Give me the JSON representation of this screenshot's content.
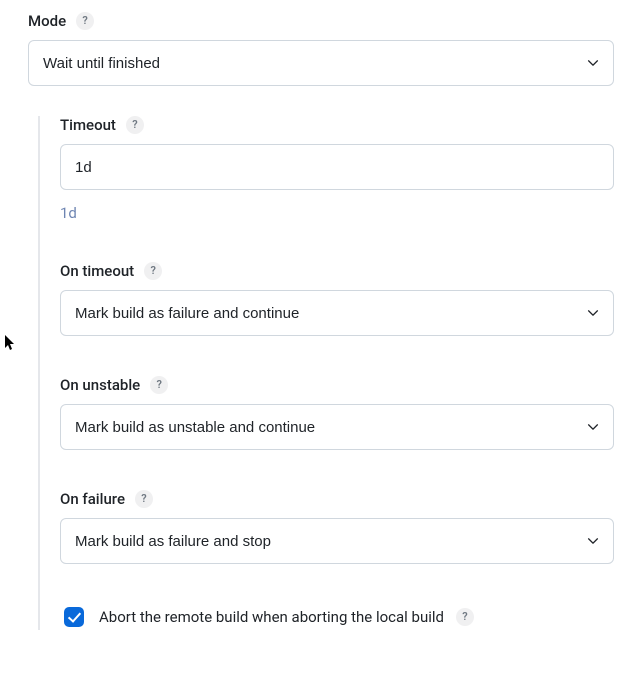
{
  "mode": {
    "label": "Mode",
    "value": "Wait until finished"
  },
  "timeout": {
    "label": "Timeout",
    "value": "1d",
    "hint": "1d"
  },
  "onTimeout": {
    "label": "On timeout",
    "value": "Mark build as failure and continue"
  },
  "onUnstable": {
    "label": "On unstable",
    "value": "Mark build as unstable and continue"
  },
  "onFailure": {
    "label": "On failure",
    "value": "Mark build as failure and stop"
  },
  "abort": {
    "label": "Abort the remote build when aborting the local build",
    "checked": true
  },
  "helpGlyph": "?"
}
